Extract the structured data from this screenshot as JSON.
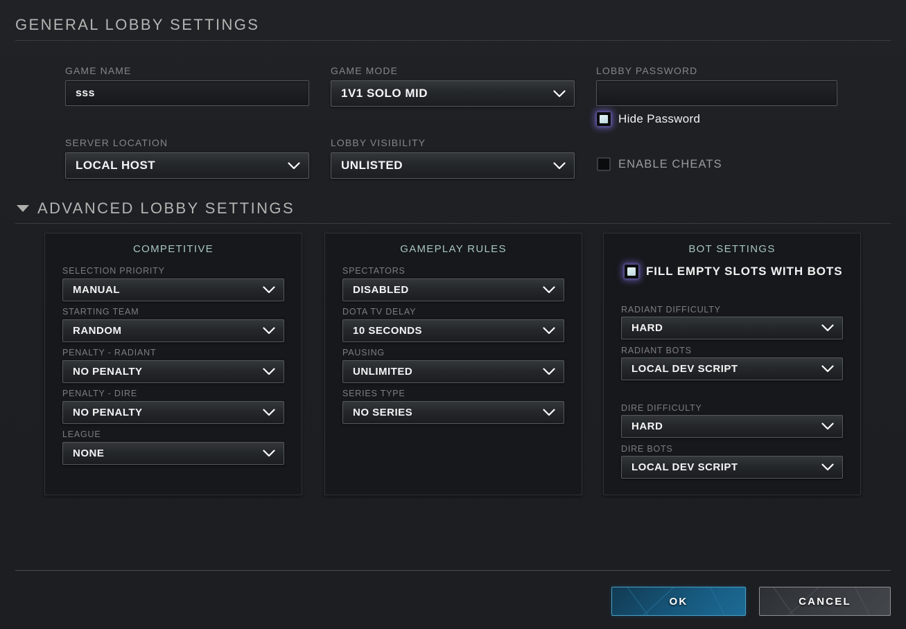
{
  "general": {
    "header": "GENERAL LOBBY SETTINGS",
    "game_name_label": "GAME NAME",
    "game_name_value": "sss",
    "game_name_placeholder": "",
    "game_mode_label": "GAME MODE",
    "game_mode_value": "1V1 SOLO MID",
    "lobby_password_label": "LOBBY PASSWORD",
    "lobby_password_value": "",
    "lobby_password_placeholder": "",
    "hide_password_label": "Hide Password",
    "hide_password_checked": true,
    "server_location_label": "SERVER LOCATION",
    "server_location_value": "LOCAL HOST",
    "lobby_visibility_label": "LOBBY VISIBILITY",
    "lobby_visibility_value": "UNLISTED",
    "enable_cheats_label": "ENABLE CHEATS",
    "enable_cheats_checked": false
  },
  "advanced": {
    "header": "ADVANCED LOBBY SETTINGS",
    "expanded": true,
    "competitive": {
      "title": "COMPETITIVE",
      "fields": [
        {
          "label": "SELECTION PRIORITY",
          "value": "MANUAL"
        },
        {
          "label": "STARTING TEAM",
          "value": "RANDOM"
        },
        {
          "label": "PENALTY - RADIANT",
          "value": "NO PENALTY"
        },
        {
          "label": "PENALTY - DIRE",
          "value": "NO PENALTY"
        },
        {
          "label": "LEAGUE",
          "value": "NONE"
        }
      ]
    },
    "gameplay_rules": {
      "title": "GAMEPLAY RULES",
      "fields": [
        {
          "label": "SPECTATORS",
          "value": "DISABLED"
        },
        {
          "label": "DOTA TV DELAY",
          "value": "10 SECONDS"
        },
        {
          "label": "PAUSING",
          "value": "UNLIMITED"
        },
        {
          "label": "SERIES TYPE",
          "value": "NO SERIES"
        }
      ]
    },
    "bot_settings": {
      "title": "BOT SETTINGS",
      "fill_empty_label": "FILL EMPTY SLOTS WITH BOTS",
      "fill_empty_checked": true,
      "fields": [
        {
          "label": "RADIANT DIFFICULTY",
          "value": "HARD"
        },
        {
          "label": "RADIANT BOTS",
          "value": "LOCAL DEV SCRIPT"
        },
        {
          "label": "DIRE DIFFICULTY",
          "value": "HARD"
        },
        {
          "label": "DIRE BOTS",
          "value": "LOCAL DEV SCRIPT"
        }
      ]
    }
  },
  "footer": {
    "ok_label": "OK",
    "cancel_label": "CANCEL"
  },
  "colors": {
    "background": "#1d1f23",
    "panel_bg": "#16181b",
    "panel_title": "#a9c4c4",
    "label": "#85868a",
    "value": "#f4f4f4",
    "header": "#b6b4b2",
    "ok_button": "#17587d",
    "ok_border": "#4aa0c6",
    "cancel_button": "#3a3e43",
    "checkbox_checked_fill": "#dcecef",
    "checkbox_glow": "#786ddc"
  }
}
